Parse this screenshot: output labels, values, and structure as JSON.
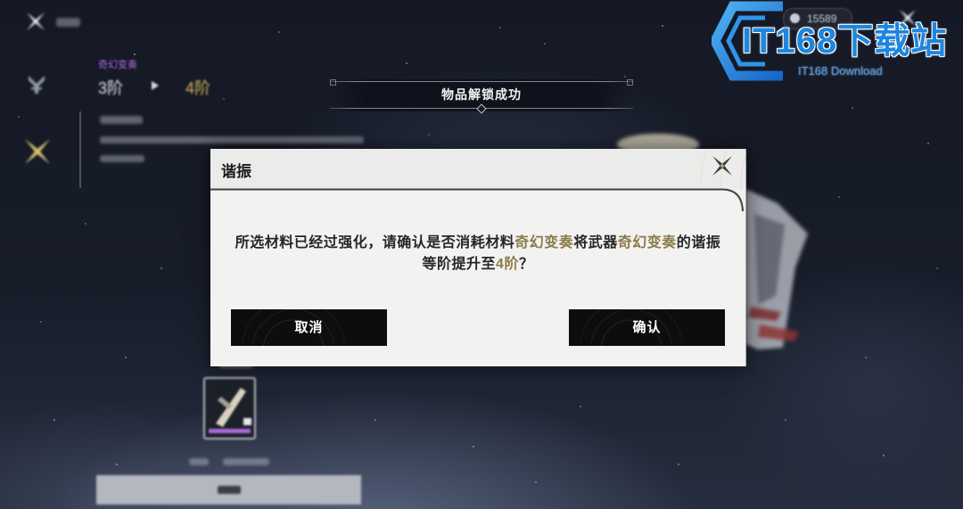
{
  "top_bar": {
    "currency_value": "15589"
  },
  "weapon_summary": {
    "weapon_name": "奇幻变奏",
    "current_rank": "3阶",
    "next_rank": "4阶"
  },
  "notification": {
    "text": "物品解锁成功"
  },
  "dialog": {
    "title": "谐振",
    "message_line1": [
      {
        "text": "所选材料已经过强化，请确认是否消耗材料"
      },
      {
        "text": "奇幻变奏",
        "accent": true
      },
      {
        "text": "将武器"
      },
      {
        "text": "奇幻变奏",
        "accent": true
      },
      {
        "text": "的谐振"
      }
    ],
    "message_line2": [
      {
        "text": "等阶提升至"
      },
      {
        "text": "4阶",
        "accent": true
      },
      {
        "text": "？"
      }
    ],
    "cancel_label": "取消",
    "confirm_label": "确认"
  },
  "watermark": {
    "brand": "IT168下载站",
    "subtitle": "IT168 Download"
  },
  "icons": {
    "back": "back-x-icon",
    "sidebar_weapon": "weapon-icon",
    "sidebar_syntonize": "crossed-blades-icon",
    "rank_arrow": "arrow-right-icon",
    "currency": "coin-icon",
    "top_close": "close-icon",
    "dialog_close": "close-icon",
    "watermark_logo": "watermark-logo-icon"
  },
  "colors": {
    "accent_text": "#8c7a4c",
    "rank_up": "#d6b75a",
    "weapon_rarity": "#a86ad8",
    "dialog_bg": "#efefed",
    "button_bg": "#0d0d0d",
    "watermark_blue": "#1d86e0"
  }
}
